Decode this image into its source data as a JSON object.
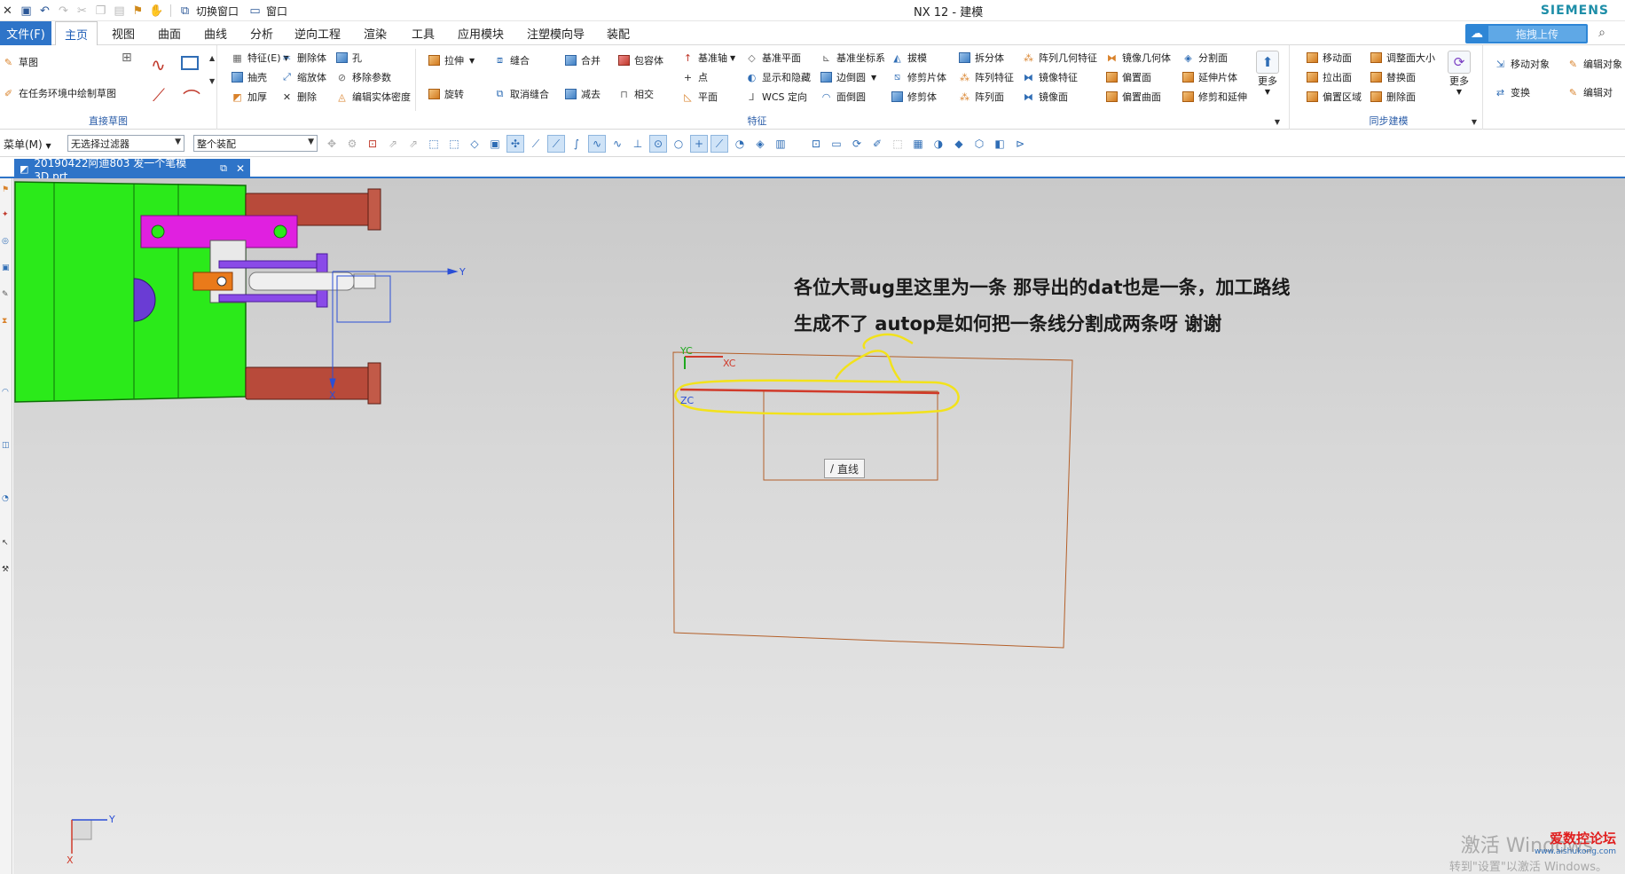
{
  "app": {
    "title": "NX 12 - 建模",
    "brand": "SIEMENS"
  },
  "quick_access": {
    "switch_window": "切换窗口",
    "window": "窗口"
  },
  "menu": {
    "file": "文件(F)",
    "tabs": [
      "主页",
      "视图",
      "曲面",
      "曲线",
      "分析",
      "逆向工程",
      "渲染",
      "工具",
      "应用模块",
      "注塑模向导",
      "装配"
    ],
    "active_tab": "主页",
    "upload_label": "拖拽上传"
  },
  "ribbon": {
    "direct_sketch": {
      "label": "直接草图",
      "sketch": "草图",
      "in_task_sketch": "在任务环境中绘制草图"
    },
    "feature": {
      "label": "特征",
      "col1": [
        "特征(E)",
        "抽壳",
        "加厚"
      ],
      "col2": [
        "删除体",
        "缩放体",
        "删除"
      ],
      "col3": [
        "孔",
        "移除参数",
        "编辑实体密度"
      ],
      "col4": [
        "拉伸",
        "旋转"
      ],
      "col5": [
        "缝合",
        "取消缝合"
      ],
      "col6": [
        "合并",
        "减去"
      ],
      "col7": [
        "包容体",
        "相交"
      ],
      "col8": [
        "基准轴",
        "点",
        "平面"
      ],
      "col9": [
        "基准平面",
        "显示和隐藏",
        "WCS 定向"
      ],
      "col10": [
        "基准坐标系",
        "边倒圆",
        "面倒圆"
      ],
      "col11": [
        "拔模",
        "修剪片体",
        "修剪体"
      ],
      "col12": [
        "拆分体",
        "阵列特征",
        "阵列面"
      ],
      "col13": [
        "阵列几何特征",
        "镜像特征",
        "镜像面"
      ],
      "col14": [
        "镜像几何体",
        "偏置面",
        "偏置曲面"
      ],
      "col15": [
        "分割面",
        "延伸片体",
        "修剪和延伸"
      ],
      "more": "更多"
    },
    "sync": {
      "label": "同步建模",
      "col1": [
        "移动面",
        "拉出面",
        "偏置区域"
      ],
      "col2": [
        "调整面大小",
        "替换面",
        "删除面"
      ],
      "more": "更多"
    },
    "transform": {
      "items": [
        "移动对象",
        "变换"
      ],
      "edit": [
        "编辑对象",
        "编辑对"
      ]
    }
  },
  "toolbar": {
    "menu": "菜单(M)",
    "filter": "无选择过滤器",
    "scope": "整个装配"
  },
  "document": {
    "tab_title": "20190422阿迪803 发一个笔模3D.prt"
  },
  "viewport": {
    "question_text": "各位大哥ug里这里为一条  那导出的dat也是一条，加工路线生成不了  autop是如何把一条线分割成两条呀  谢谢",
    "tooltip": "直线",
    "axes_labels": {
      "yc": "YC",
      "xc": "XC",
      "zc": "ZC",
      "y": "Y",
      "x": "X"
    },
    "activate_windows": "激活 Windows",
    "activate_hint": "转到\"设置\"以激活 Windows。",
    "watermark_site": "爱数控论坛",
    "watermark_url": "www.aishukong.com"
  },
  "colors": {
    "accent": "#2e74c8",
    "model_green": "#2bea1a",
    "model_magenta": "#e020e0",
    "rod_red": "#b84a3a",
    "sketch_line": "#c0392b",
    "annotation_yellow": "#f2e21b"
  }
}
